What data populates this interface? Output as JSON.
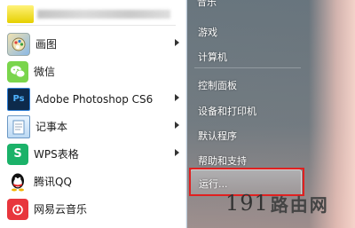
{
  "left_pane": {
    "programs": [
      {
        "label": "画图",
        "icon": "paint-icon",
        "has_submenu": true
      },
      {
        "label": "微信",
        "icon": "wechat-icon",
        "has_submenu": false
      },
      {
        "label": "Adobe Photoshop CS6",
        "icon": "photoshop-icon",
        "icon_text": "Ps",
        "has_submenu": true
      },
      {
        "label": "记事本",
        "icon": "notepad-icon",
        "has_submenu": true
      },
      {
        "label": "WPS表格",
        "icon": "wps-icon",
        "icon_text": "S",
        "has_submenu": true
      },
      {
        "label": "腾讯QQ",
        "icon": "qq-icon",
        "has_submenu": false
      },
      {
        "label": "网易云音乐",
        "icon": "netease-music-icon",
        "has_submenu": false
      }
    ]
  },
  "right_pane": {
    "items": [
      {
        "label": "音乐"
      },
      {
        "label": "游戏"
      },
      {
        "label": "计算机"
      },
      {
        "label": "控制面板"
      },
      {
        "label": "设备和打印机"
      },
      {
        "label": "默认程序"
      },
      {
        "label": "帮助和支持"
      }
    ],
    "run": {
      "label": "运行..."
    }
  },
  "watermark": {
    "number": "191",
    "text": "路由网"
  },
  "colors": {
    "highlight": "#e02020",
    "right_pane_bg": "#4a6270",
    "wps_green": "#1bb269",
    "music_red": "#e8363d"
  }
}
